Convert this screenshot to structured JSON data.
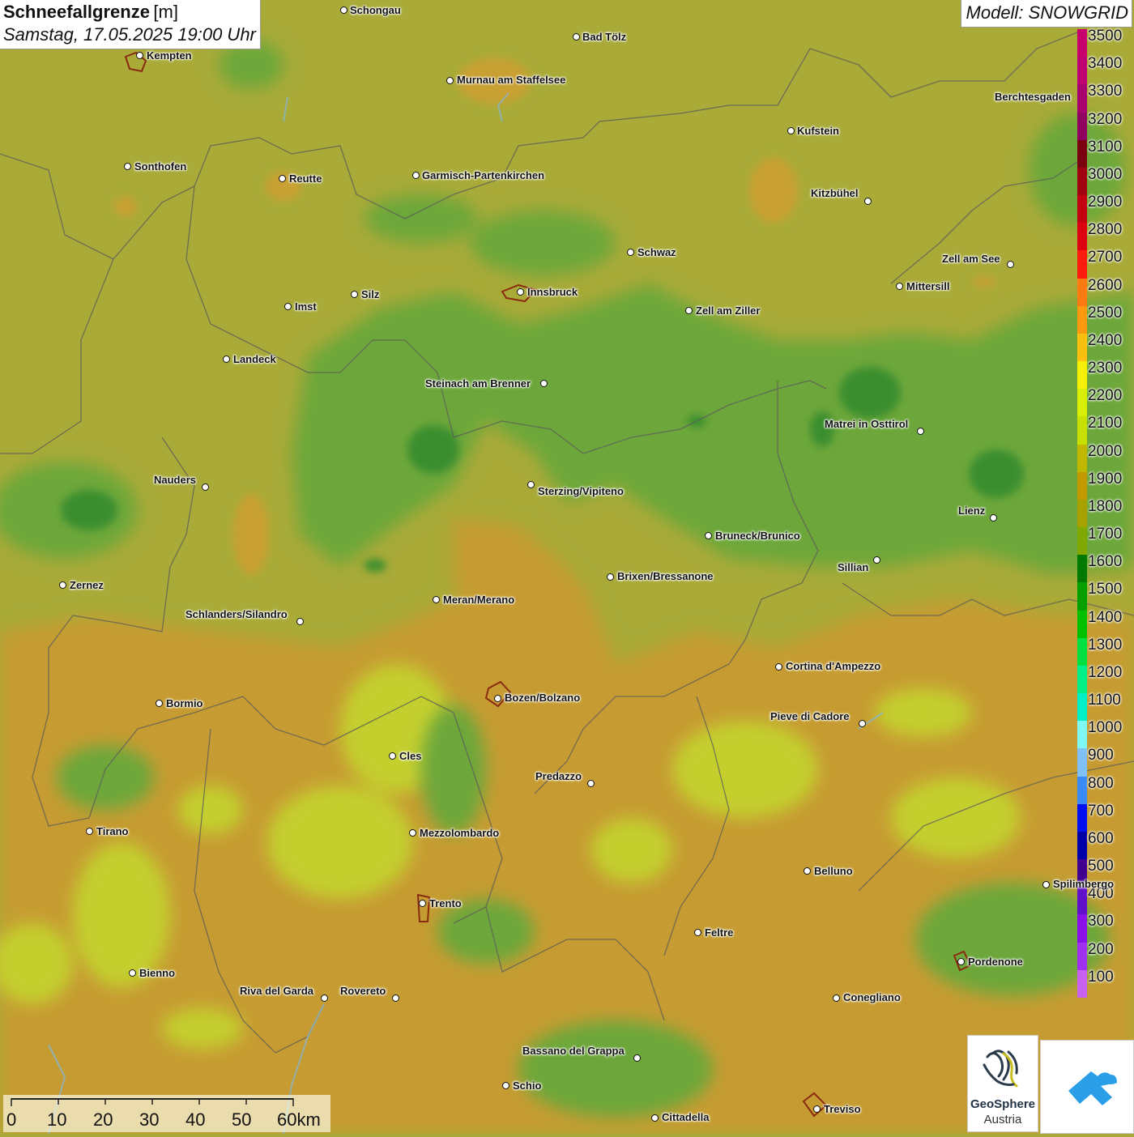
{
  "title": {
    "main": "Schneefallgrenze",
    "unit": "[m]",
    "date": "Samstag, 17.05.2025 19:00 Uhr"
  },
  "model": "Modell: SNOWGRID",
  "legend": {
    "levels": [
      {
        "label": "3500",
        "color": "#c8006e"
      },
      {
        "label": "3400",
        "color": "#be0072"
      },
      {
        "label": "3300",
        "color": "#a8006c"
      },
      {
        "label": "3200",
        "color": "#900060"
      },
      {
        "label": "3100",
        "color": "#7a0010"
      },
      {
        "label": "3000",
        "color": "#a00010"
      },
      {
        "label": "2900",
        "color": "#c20012"
      },
      {
        "label": "2800",
        "color": "#dc0010"
      },
      {
        "label": "2700",
        "color": "#ff1a10"
      },
      {
        "label": "2600",
        "color": "#ff7a10"
      },
      {
        "label": "2500",
        "color": "#ff9a10"
      },
      {
        "label": "2400",
        "color": "#ffc010"
      },
      {
        "label": "2300",
        "color": "#f6f000"
      },
      {
        "label": "2200",
        "color": "#d8f000"
      },
      {
        "label": "2100",
        "color": "#c8e000"
      },
      {
        "label": "2000",
        "color": "#c0b800"
      },
      {
        "label": "1900",
        "color": "#c09a00"
      },
      {
        "label": "1800",
        "color": "#a6a000"
      },
      {
        "label": "1700",
        "color": "#80a800"
      },
      {
        "label": "1600",
        "color": "#007a00"
      },
      {
        "label": "1500",
        "color": "#00a000"
      },
      {
        "label": "1400",
        "color": "#00c000"
      },
      {
        "label": "1300",
        "color": "#00e040"
      },
      {
        "label": "1200",
        "color": "#00f08a"
      },
      {
        "label": "1100",
        "color": "#00f0c8"
      },
      {
        "label": "1000",
        "color": "#80f8f8"
      },
      {
        "label": "900",
        "color": "#80c0f8"
      },
      {
        "label": "800",
        "color": "#3a8af8"
      },
      {
        "label": "700",
        "color": "#0010f0"
      },
      {
        "label": "600",
        "color": "#0000a8"
      },
      {
        "label": "500",
        "color": "#400090"
      },
      {
        "label": "400",
        "color": "#6010c8"
      },
      {
        "label": "300",
        "color": "#8a10e8"
      },
      {
        "label": "200",
        "color": "#a030f0"
      },
      {
        "label": "100",
        "color": "#c860f0"
      }
    ]
  },
  "cities": [
    {
      "name": "Schongau"
    },
    {
      "name": "Bad Tölz"
    },
    {
      "name": "Kempten"
    },
    {
      "name": "Murnau am Staffelsee"
    },
    {
      "name": "Berchtesgaden"
    },
    {
      "name": "Kufstein"
    },
    {
      "name": "Sonthofen"
    },
    {
      "name": "Reutte"
    },
    {
      "name": "Garmisch-Partenkirchen"
    },
    {
      "name": "Kitzbühel"
    },
    {
      "name": "Schwaz"
    },
    {
      "name": "Zell am See"
    },
    {
      "name": "Innsbruck"
    },
    {
      "name": "Mittersill"
    },
    {
      "name": "Silz"
    },
    {
      "name": "Imst"
    },
    {
      "name": "Zell am Ziller"
    },
    {
      "name": "Landeck"
    },
    {
      "name": "Steinach am Brenner"
    },
    {
      "name": "Matrei in Osttirol"
    },
    {
      "name": "Nauders"
    },
    {
      "name": "Sterzing/Vipiteno"
    },
    {
      "name": "Lienz"
    },
    {
      "name": "Bruneck/Brunico"
    },
    {
      "name": "Sillian"
    },
    {
      "name": "Zernez"
    },
    {
      "name": "Brixen/Bressanone"
    },
    {
      "name": "Meran/Merano"
    },
    {
      "name": "Schlanders/Silandro"
    },
    {
      "name": "Cortina d'Ampezzo"
    },
    {
      "name": "Bozen/Bolzano"
    },
    {
      "name": "Bormio"
    },
    {
      "name": "Pieve di Cadore"
    },
    {
      "name": "Cles"
    },
    {
      "name": "Predazzo"
    },
    {
      "name": "Tirano"
    },
    {
      "name": "Mezzolombardo"
    },
    {
      "name": "Belluno"
    },
    {
      "name": "Spilimbergo"
    },
    {
      "name": "Trento"
    },
    {
      "name": "Feltre"
    },
    {
      "name": "Pordenone"
    },
    {
      "name": "Bienno"
    },
    {
      "name": "Riva del Garda"
    },
    {
      "name": "Rovereto"
    },
    {
      "name": "Conegliano"
    },
    {
      "name": "Bassano del Grappa"
    },
    {
      "name": "Schio"
    },
    {
      "name": "Treviso"
    },
    {
      "name": "Cittadella"
    }
  ],
  "scale": {
    "labels": [
      "0",
      "10",
      "20",
      "30",
      "40",
      "50",
      "60km"
    ]
  },
  "logos": {
    "geosphere_line1": "GeoSphere",
    "geosphere_line2": "Austria",
    "second_logo": "weather-app-icon"
  },
  "colors": {
    "base_terrain": "#a8a93a",
    "green_low": "#6fa83a",
    "green_dark": "#3d8f2e",
    "orange": "#c9a030",
    "yellow": "#c8d030"
  }
}
